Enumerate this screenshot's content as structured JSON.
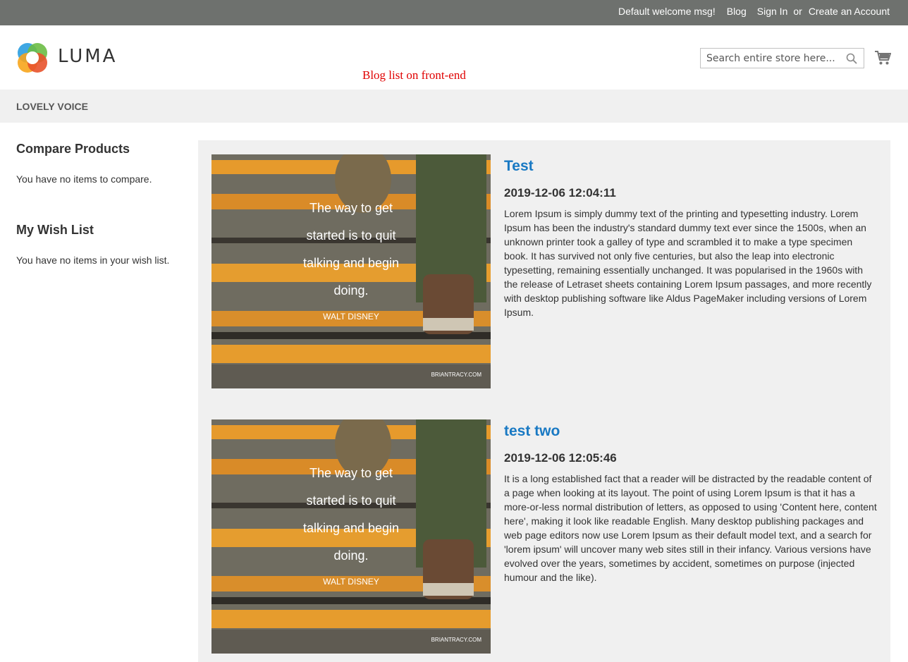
{
  "top_panel": {
    "welcome": "Default welcome msg!",
    "blog_link": "Blog",
    "sign_in": "Sign In",
    "or_text": "or",
    "create_account": "Create an Account"
  },
  "header": {
    "logo_text": "LUMA",
    "annotation": "Blog list on front-end",
    "search_placeholder": "Search entire store here...",
    "icons": [
      "search-icon",
      "cart-icon"
    ]
  },
  "nav": {
    "items": [
      {
        "label": "LOVELY VOICE"
      }
    ]
  },
  "sidebar": {
    "compare": {
      "title": "Compare Products",
      "text": "You have no items to compare."
    },
    "wishlist": {
      "title": "My Wish List",
      "text": "You have no items in your wish list."
    }
  },
  "posts": [
    {
      "title": "Test",
      "date": "2019-12-06 12:04:11",
      "body": "Lorem Ipsum is simply dummy text of the printing and typesetting industry. Lorem Ipsum has been the industry's standard dummy text ever since the 1500s, when an unknown printer took a galley of type and scrambled it to make a type specimen book. It has survived not only five centuries, but also the leap into electronic typesetting, remaining essentially unchanged. It was popularised in the 1960s with the release of Letraset sheets containing Lorem Ipsum passages, and more recently with desktop publishing software like Aldus PageMaker including versions of Lorem Ipsum.",
      "image": {
        "quote_lines": [
          "The way to get",
          "started is to quit",
          "talking and begin",
          "doing."
        ],
        "author": "WALT DISNEY",
        "credit": "BRIANTRACY.COM"
      }
    },
    {
      "title": "test two",
      "date": "2019-12-06 12:05:46",
      "body": "It is a long established fact that a reader will be distracted by the readable content of a page when looking at its layout. The point of using Lorem Ipsum is that it has a more-or-less normal distribution of letters, as opposed to using 'Content here, content here', making it look like readable English. Many desktop publishing packages and web page editors now use Lorem Ipsum as their default model text, and a search for 'lorem ipsum' will uncover many web sites still in their infancy. Various versions have evolved over the years, sometimes by accident, sometimes on purpose (injected humour and the like).",
      "image": {
        "quote_lines": [
          "The way to get",
          "started is to quit",
          "talking and begin",
          "doing."
        ],
        "author": "WALT DISNEY",
        "credit": "BRIANTRACY.COM"
      }
    }
  ],
  "colors": {
    "top_panel_bg": "#6e716e",
    "nav_bg": "#f0f0f0",
    "link_blue": "#1979c3",
    "annotation_red": "#e00000"
  }
}
